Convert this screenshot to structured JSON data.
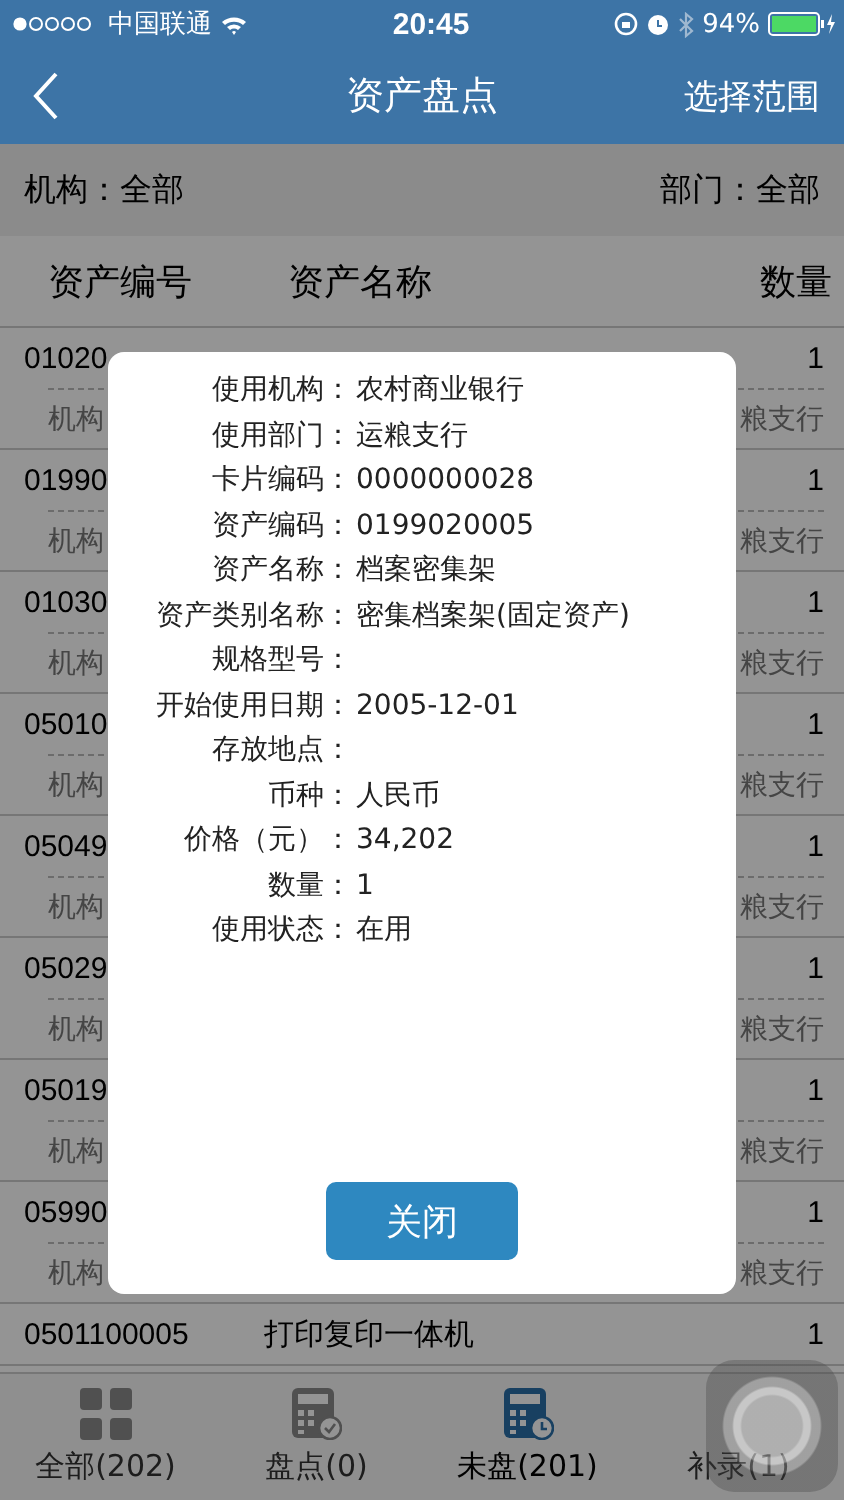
{
  "status_bar": {
    "carrier": "中国联通",
    "time": "20:45",
    "battery": "94%"
  },
  "nav": {
    "title": "资产盘点",
    "action": "选择范围"
  },
  "filters": {
    "org": "机构：全部",
    "dept": "部门：全部"
  },
  "table": {
    "columns": [
      "资产编号",
      "资产名称",
      "数量"
    ],
    "rows": [
      {
        "code": "01020",
        "quantity": "1",
        "org": "机构",
        "dept": "粮支行"
      },
      {
        "code": "01990",
        "quantity": "1",
        "org": "机构",
        "dept": "粮支行"
      },
      {
        "code": "01030",
        "quantity": "1",
        "org": "机构",
        "dept": "粮支行"
      },
      {
        "code": "05010",
        "quantity": "1",
        "org": "机构",
        "dept": "粮支行"
      },
      {
        "code": "05049",
        "quantity": "1",
        "org": "机构",
        "dept": "粮支行"
      },
      {
        "code": "05029",
        "quantity": "1",
        "org": "机构",
        "dept": "粮支行"
      },
      {
        "code": "05019",
        "quantity": "1",
        "org": "机构",
        "dept": "粮支行"
      },
      {
        "code": "05990",
        "quantity": "1",
        "org": "机构",
        "dept": "粮支行"
      },
      {
        "code": "0501100005",
        "name": "打印复印一体机",
        "quantity": "1"
      }
    ]
  },
  "dialog": {
    "fields": [
      {
        "label": "使用机构：",
        "value": "农村商业银行"
      },
      {
        "label": "使用部门：",
        "value": "运粮支行"
      },
      {
        "label": "卡片编码：",
        "value": "0000000028"
      },
      {
        "label": "资产编码：",
        "value": "0199020005"
      },
      {
        "label": "资产名称：",
        "value": "档案密集架"
      },
      {
        "label": "资产类别名称：",
        "value": "密集档案架(固定资产)"
      },
      {
        "label": "规格型号："
      },
      {
        "label": "开始使用日期：",
        "value": "2005-12-01"
      },
      {
        "label": "存放地点："
      },
      {
        "label": "币种：",
        "value": "人民币"
      },
      {
        "label": "价格（元）：",
        "value": "34,202"
      },
      {
        "label": "数量：",
        "value": "1"
      },
      {
        "label": "使用状态：",
        "value": "在用"
      }
    ],
    "button": "关闭"
  },
  "tabs": [
    {
      "label": "全部(202)",
      "selected": false
    },
    {
      "label": "盘点(0)",
      "selected": false
    },
    {
      "label": "未盘(201)",
      "selected": true
    },
    {
      "label": "补录(1)",
      "selected": false
    }
  ]
}
